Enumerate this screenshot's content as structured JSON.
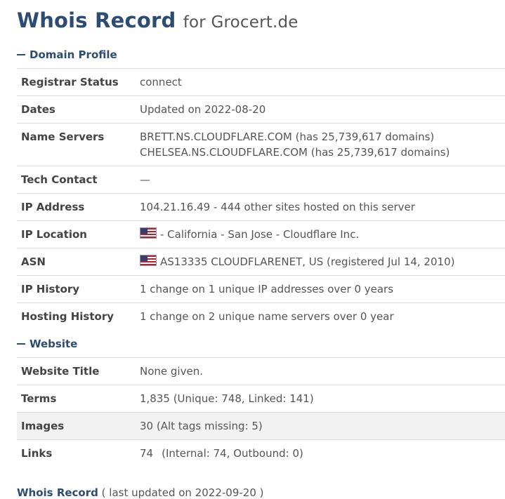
{
  "header": {
    "title": "Whois Record",
    "for_text": "for Grocert.de"
  },
  "domain_profile": {
    "heading": "Domain Profile",
    "rows": {
      "registrar_status": {
        "label": "Registrar Status",
        "value": "connect"
      },
      "dates": {
        "label": "Dates",
        "value": "Updated on 2022-08-20"
      },
      "name_servers": {
        "label": "Name Servers",
        "ns1": "BRETT.NS.CLOUDFLARE.COM (has 25,739,617 domains)",
        "ns2": "CHELSEA.NS.CLOUDFLARE.COM (has 25,739,617 domains)"
      },
      "tech_contact": {
        "label": "Tech Contact",
        "value": "—"
      },
      "ip_address": {
        "label": "IP Address",
        "value": "104.21.16.49 - 444 other sites hosted on this server"
      },
      "ip_location": {
        "label": "IP Location",
        "value": "- California - San Jose - Cloudflare Inc.",
        "flag": "us-flag-icon"
      },
      "asn": {
        "label": "ASN",
        "value": "AS13335 CLOUDFLARENET, US (registered Jul 14, 2010)",
        "flag": "us-flag-icon"
      },
      "ip_history": {
        "label": "IP History",
        "value": "1 change on 1 unique IP addresses over 0 years"
      },
      "hosting_history": {
        "label": "Hosting History",
        "value": "1 change on 2 unique name servers over 0 year"
      }
    }
  },
  "website": {
    "heading": "Website",
    "rows": {
      "website_title": {
        "label": "Website Title",
        "value": "None given."
      },
      "terms": {
        "label": "Terms",
        "value": "1,835 (Unique: 748, Linked: 141)"
      },
      "images": {
        "label": "Images",
        "value": "30 (Alt tags missing: 5)"
      },
      "links": {
        "label": "Links",
        "count": "74",
        "detail": "(Internal: 74, Outbound: 0)"
      }
    }
  },
  "footer": {
    "strong": "Whois Record",
    "muted": "( last updated on 2022-09-20 )"
  },
  "colors": {
    "heading": "#2c4c73",
    "text": "#555555",
    "row_border": "#dcdcdc",
    "shaded_row": "#f2f2f2"
  }
}
